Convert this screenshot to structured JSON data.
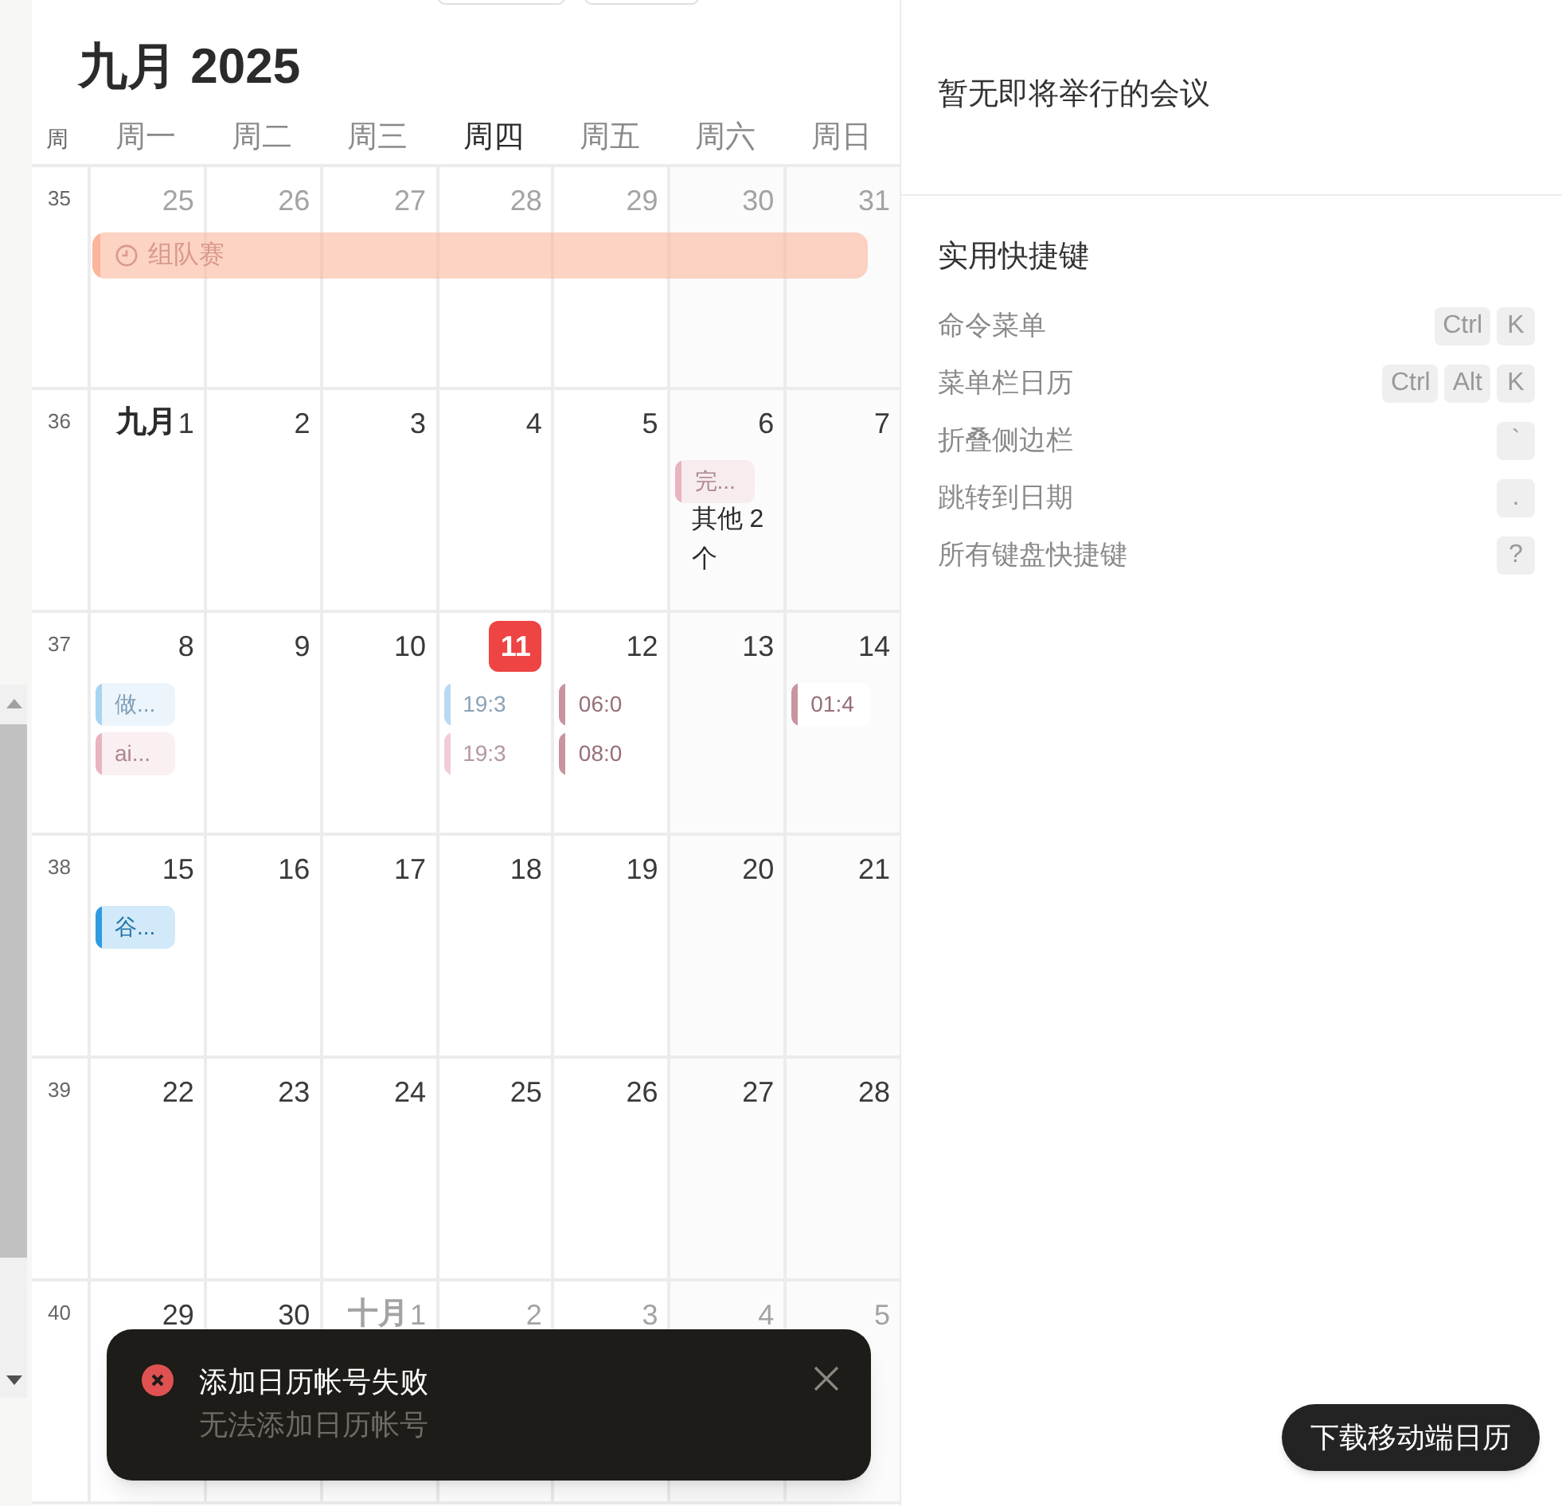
{
  "calendar": {
    "title": "九月 2025",
    "week_header": "周",
    "weekdays": [
      {
        "label": "周一",
        "selected": false
      },
      {
        "label": "周二",
        "selected": false
      },
      {
        "label": "周三",
        "selected": false
      },
      {
        "label": "周四",
        "selected": true
      },
      {
        "label": "周五",
        "selected": false
      },
      {
        "label": "周六",
        "selected": false
      },
      {
        "label": "周日",
        "selected": false
      }
    ],
    "weeks": [
      {
        "number": "35",
        "spanning_events": [
          {
            "title": "组队赛",
            "color": "#fbb59b"
          }
        ],
        "days": [
          {
            "date": "25",
            "muted": true,
            "today": false
          },
          {
            "date": "26",
            "muted": true,
            "today": false
          },
          {
            "date": "27",
            "muted": true,
            "today": false
          },
          {
            "date": "28",
            "muted": true,
            "today": false
          },
          {
            "date": "29",
            "muted": true,
            "today": false
          },
          {
            "date": "30",
            "muted": true,
            "today": false
          },
          {
            "date": "31",
            "muted": true,
            "today": false
          }
        ]
      },
      {
        "number": "36",
        "days": [
          {
            "month": "九月",
            "date": "1",
            "muted": false,
            "today": false
          },
          {
            "date": "2",
            "muted": false,
            "today": false
          },
          {
            "date": "3",
            "muted": false,
            "today": false
          },
          {
            "date": "4",
            "muted": false,
            "today": false
          },
          {
            "date": "5",
            "muted": false,
            "today": false
          },
          {
            "date": "6",
            "muted": false,
            "today": false,
            "events": [
              {
                "kind": "chip",
                "text": "完...",
                "color": "#e8b4bf"
              }
            ],
            "more": "其他 2 个"
          },
          {
            "date": "7",
            "muted": false,
            "today": false
          }
        ]
      },
      {
        "number": "37",
        "days": [
          {
            "date": "8",
            "muted": false,
            "today": false,
            "events": [
              {
                "kind": "chip",
                "text": "做...",
                "color": "#a9d3f2"
              },
              {
                "kind": "chip",
                "text": "ai...",
                "color": "#e8b4bf"
              }
            ]
          },
          {
            "date": "9",
            "muted": false,
            "today": false
          },
          {
            "date": "10",
            "muted": false,
            "today": false
          },
          {
            "date": "11",
            "muted": false,
            "today": true,
            "events": [
              {
                "kind": "time",
                "text": "19:3",
                "color": "#b9d8f2"
              },
              {
                "kind": "time",
                "text": "19:3",
                "color": "#f0cdd4"
              }
            ]
          },
          {
            "date": "12",
            "muted": false,
            "today": false,
            "events": [
              {
                "kind": "time",
                "text": "06:0",
                "color": "#c8949f"
              },
              {
                "kind": "time",
                "text": "08:0",
                "color": "#c8949f"
              }
            ]
          },
          {
            "date": "13",
            "muted": false,
            "today": false
          },
          {
            "date": "14",
            "muted": false,
            "today": false,
            "events": [
              {
                "kind": "time",
                "text": "01:4",
                "color": "#c8949f"
              }
            ]
          }
        ]
      },
      {
        "number": "38",
        "days": [
          {
            "date": "15",
            "muted": false,
            "today": false,
            "events": [
              {
                "kind": "chip",
                "text": "谷...",
                "color": "#2f9be0"
              }
            ]
          },
          {
            "date": "16",
            "muted": false,
            "today": false
          },
          {
            "date": "17",
            "muted": false,
            "today": false
          },
          {
            "date": "18",
            "muted": false,
            "today": false
          },
          {
            "date": "19",
            "muted": false,
            "today": false
          },
          {
            "date": "20",
            "muted": false,
            "today": false
          },
          {
            "date": "21",
            "muted": false,
            "today": false
          }
        ]
      },
      {
        "number": "39",
        "days": [
          {
            "date": "22",
            "muted": false,
            "today": false
          },
          {
            "date": "23",
            "muted": false,
            "today": false
          },
          {
            "date": "24",
            "muted": false,
            "today": false
          },
          {
            "date": "25",
            "muted": false,
            "today": false
          },
          {
            "date": "26",
            "muted": false,
            "today": false
          },
          {
            "date": "27",
            "muted": false,
            "today": false
          },
          {
            "date": "28",
            "muted": false,
            "today": false
          }
        ]
      },
      {
        "number": "40",
        "days": [
          {
            "date": "29",
            "muted": false,
            "today": false
          },
          {
            "date": "30",
            "muted": false,
            "today": false
          },
          {
            "month": "十月",
            "date": "1",
            "muted": true,
            "today": false
          },
          {
            "date": "2",
            "muted": true,
            "today": false
          },
          {
            "date": "3",
            "muted": true,
            "today": false
          },
          {
            "date": "4",
            "muted": true,
            "today": false
          },
          {
            "date": "5",
            "muted": true,
            "today": false
          }
        ]
      }
    ]
  },
  "sidebar": {
    "upcoming": "暂无即将举行的会议",
    "shortcuts_title": "实用快捷键",
    "shortcuts": [
      {
        "label": "命令菜单",
        "keys": [
          "Ctrl",
          "K"
        ]
      },
      {
        "label": "菜单栏日历",
        "keys": [
          "Ctrl",
          "Alt",
          "K"
        ]
      },
      {
        "label": "折叠侧边栏",
        "keys": [
          "`"
        ]
      },
      {
        "label": "跳转到日期",
        "keys": [
          "."
        ]
      },
      {
        "label": "所有键盘快捷键",
        "keys": [
          "?"
        ]
      }
    ],
    "download_button": "下载移动端日历"
  },
  "toast": {
    "kind": "error",
    "title": "添加日历帐号失败",
    "message": "无法添加日历帐号"
  }
}
